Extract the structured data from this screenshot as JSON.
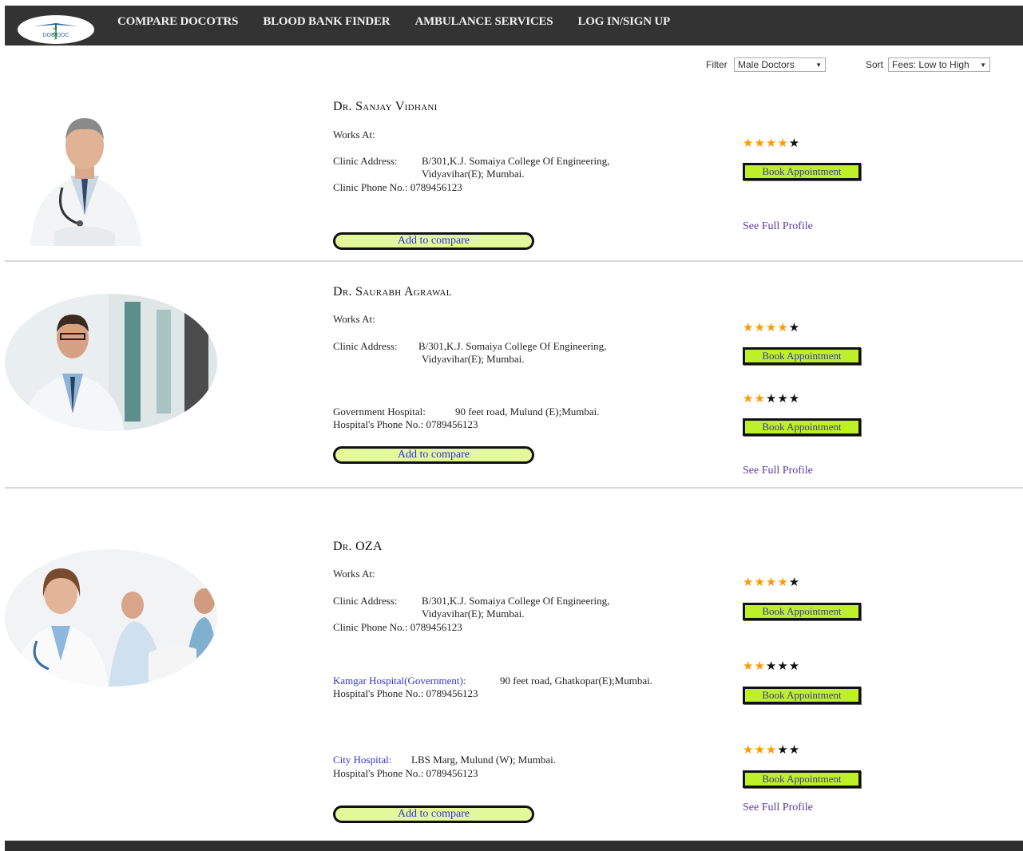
{
  "nav": {
    "logo_text": "DOC DOC",
    "links": [
      "COMPARE DOCOTRS",
      "BLOOD BANK FINDER",
      "AMBULANCE SERVICES",
      "LOG IN/SIGN UP"
    ]
  },
  "controls": {
    "filter_label": "Filter",
    "filter_value": "Male Doctors",
    "sort_label": "Sort",
    "sort_value": "Fees: Low to High"
  },
  "common": {
    "works_at": "Works At:",
    "clinic_address_label": "Clinic Address:",
    "clinic_phone_label": "Clinic Phone No.:",
    "hospital_phone_label": "Hospital's Phone No.:",
    "add_to_compare": "Add to compare",
    "book_appointment": "Book Appointment",
    "see_full_profile": "See Full Profile"
  },
  "doctors": [
    {
      "name": "Dr. Sanjay Vidhani",
      "clinic_address_line1": "B/301,K.J. Somaiya College Of Engineering,",
      "clinic_address_line2": "Vidyavihar(E); Mumbai.",
      "clinic_phone": "0789456123",
      "ratings": [
        4
      ]
    },
    {
      "name": "Dr. Saurabh Agrawal",
      "clinic_address_line1": "B/301,K.J. Somaiya College Of Engineering,",
      "clinic_address_line2": "Vidyavihar(E); Mumbai.",
      "hospital_label": "Government Hospital:",
      "hospital_address": "90 feet road, Mulund (E);Mumbai.",
      "hospital_phone": "0789456123",
      "ratings": [
        4,
        2
      ]
    },
    {
      "name": "Dr. OZA",
      "clinic_address_line1": "B/301,K.J. Somaiya College Of Engineering,",
      "clinic_address_line2": "Vidyavihar(E); Mumbai.",
      "clinic_phone": "0789456123",
      "hospital1_label": "Kamgar Hospital(Government):",
      "hospital1_address": "90 feet road, Ghatkopar(E);Mumbai.",
      "hospital1_phone": "0789456123",
      "hospital2_label": "City Hospital:",
      "hospital2_address": "LBS Marg, Mulund (W); Mumbai.",
      "hospital2_phone": "0789456123",
      "ratings": [
        4,
        2,
        3
      ]
    }
  ],
  "colors": {
    "navbar": "#333333",
    "star_on": "#ff9900",
    "book_button": "#bdf027",
    "compare_button": "#e3f79b",
    "link": "#3333cc"
  }
}
